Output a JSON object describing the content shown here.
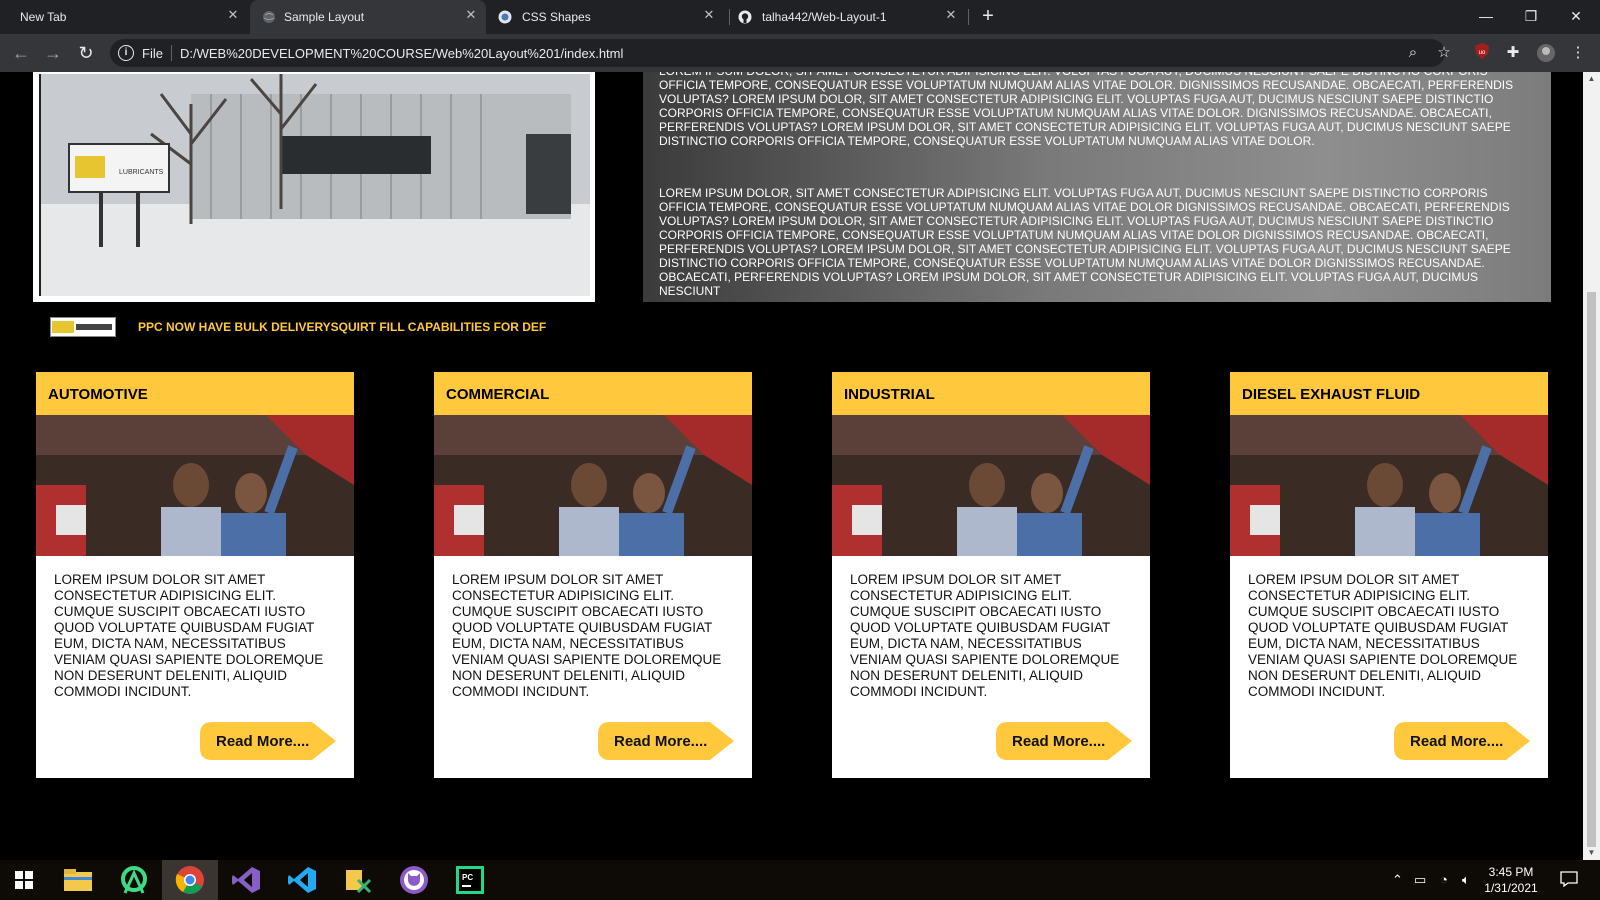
{
  "browser": {
    "tabs": [
      {
        "title": "New Tab",
        "active": false
      },
      {
        "title": "Sample Layout",
        "active": true
      },
      {
        "title": "CSS Shapes",
        "active": false
      },
      {
        "title": "talha442/Web-Layout-1",
        "active": false
      }
    ],
    "omnibox": {
      "scheme_label": "File",
      "url": "D:/WEB%20DEVELOPMENT%20COURSE/Web%20Layout%201/index.html"
    },
    "icons": {
      "back": "arrow-left-icon",
      "forward": "arrow-right-icon",
      "reload": "reload-icon",
      "zoom": "zoom-icon",
      "bookmark": "star-icon",
      "extension": "puzzle-icon",
      "menu": "kebab-icon"
    }
  },
  "page": {
    "hero_paragraphs": [
      "Lorem ipsum dolor, sit amet consectetur adipisicing elit. Voluptas fuga aut, ducimus nesciunt saepe distinctio corporis officia tempore, consequatur esse voluptatum numquam alias vitae dolor. Dignissimos recusandae. Obcaecati, perferendis voluptas? Lorem ipsum dolor, sit amet consectetur adipisicing elit. Voluptas fuga aut, ducimus nesciunt saepe distinctio corporis officia tempore, consequatur esse voluptatum numquam alias vitae dolor. Dignissimos recusandae. Obcaecati, perferendis voluptas? Lorem ipsum dolor, sit amet consectetur adipisicing elit. Voluptas fuga aut, ducimus nesciunt saepe distinctio corporis officia tempore, consequatur esse voluptatum numquam alias vitae dolor.",
      "Lorem ipsum dolor, sit amet consectetur adipisicing elit. Voluptas fuga aut, ducimus nesciunt saepe distinctio corporis officia tempore, consequatur esse voluptatum numquam alias vitae dolor dignissimos recusandae. Obcaecati, perferendis voluptas? Lorem ipsum dolor, sit amet consectetur adipisicing elit. Voluptas fuga aut, ducimus nesciunt saepe distinctio corporis officia tempore, consequatur esse voluptatum numquam alias vitae dolor dignissimos recusandae. Obcaecati, perferendis voluptas? Lorem ipsum dolor, sit amet consectetur adipisicing elit. Voluptas fuga aut, ducimus nesciunt saepe distinctio corporis officia tempore, consequatur esse voluptatum numquam alias vitae dolor dignissimos recusandae. Obcaecati, perferendis voluptas? Lorem ipsum dolor, sit amet consectetur adipisicing elit. Voluptas fuga aut, ducimus nesciunt"
    ],
    "news_headline": "PPC NOW HAVE BULK DELIVERYSQUIRT FILL CAPABILITIES FOR DEF",
    "accent_color": "#ffc83d",
    "cards": [
      {
        "title": "Automotive",
        "body": "Lorem ipsum dolor sit amet consectetur adipisicing elit. Cumque suscipit obcaecati iusto quod voluptate quibusdam fugiat eum, dicta nam, necessitatibus veniam quasi sapiente doloremque non deserunt deleniti, aliquid commodi incidunt.",
        "button": "Read More...."
      },
      {
        "title": "Commercial",
        "body": "Lorem ipsum dolor sit amet consectetur adipisicing elit. Cumque suscipit obcaecati iusto quod voluptate quibusdam fugiat eum, dicta nam, necessitatibus veniam quasi sapiente doloremque non deserunt deleniti, aliquid commodi incidunt.",
        "button": "Read More...."
      },
      {
        "title": "Industrial",
        "body": "Lorem ipsum dolor sit amet consectetur adipisicing elit. Cumque suscipit obcaecati iusto quod voluptate quibusdam fugiat eum, dicta nam, necessitatibus veniam quasi sapiente doloremque non deserunt deleniti, aliquid commodi incidunt.",
        "button": "Read More...."
      },
      {
        "title": "Diesel Exhaust Fluid",
        "body": "Lorem ipsum dolor sit amet consectetur adipisicing elit. Cumque suscipit obcaecati iusto quod voluptate quibusdam fugiat eum, dicta nam, necessitatibus veniam quasi sapiente doloremque non deserunt deleniti, aliquid commodi incidunt.",
        "button": "Read More...."
      }
    ]
  },
  "taskbar": {
    "apps": [
      "windows-start-icon",
      "file-explorer-icon",
      "android-studio-icon",
      "chrome-icon",
      "visual-studio-icon",
      "vscode-icon",
      "app-icon",
      "github-desktop-icon",
      "pycharm-icon"
    ],
    "time": "3:45 PM",
    "date": "1/31/2021"
  }
}
